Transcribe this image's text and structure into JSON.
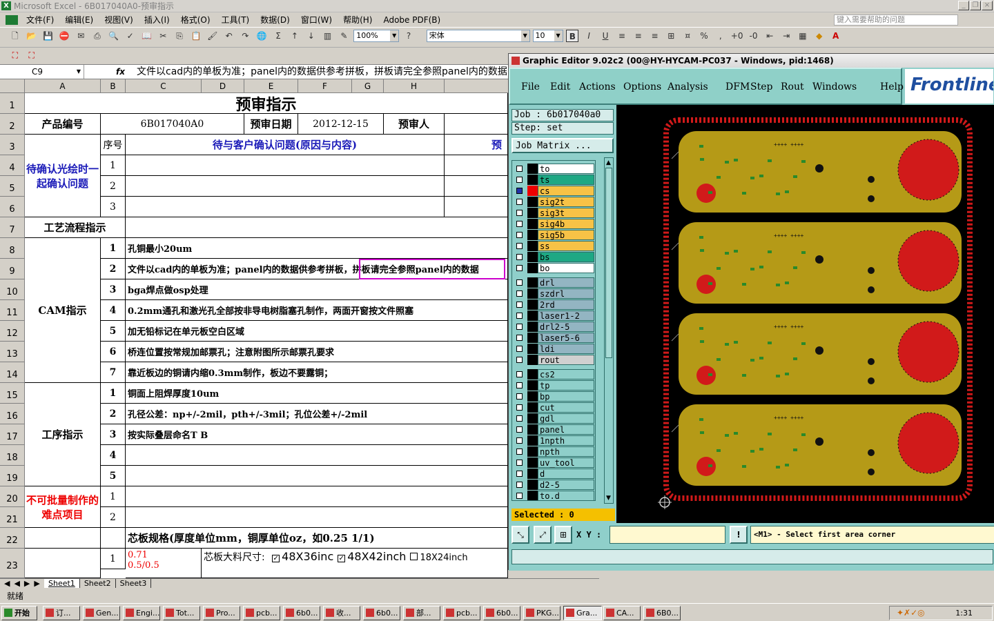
{
  "excel": {
    "title": "Microsoft Excel - 6B017040A0-预审指示",
    "menu": [
      "文件(F)",
      "编辑(E)",
      "视图(V)",
      "插入(I)",
      "格式(O)",
      "工具(T)",
      "数据(D)",
      "窗口(W)",
      "帮助(H)",
      "Adobe PDF(B)"
    ],
    "help_placeholder": "键入需要帮助的问题",
    "zoom": "100%",
    "font_name": "宋体",
    "font_size": "10",
    "name_box": "C9",
    "formula": "文件以cad内的单板为准；panel内的数据供参考拼板，拼板请完全参照panel内的数据",
    "columns": [
      "A",
      "B",
      "C",
      "D",
      "E",
      "F",
      "G",
      "H"
    ],
    "rows": [
      "1",
      "2",
      "3",
      "4",
      "5",
      "6",
      "7",
      "8",
      "9",
      "10",
      "11",
      "12",
      "13",
      "14",
      "15",
      "16",
      "17",
      "18",
      "19",
      "20",
      "21",
      "22",
      "23"
    ],
    "sheet": {
      "title": "预审指示",
      "product_label": "产品编号",
      "product_value": "6B017040A0",
      "date_label": "预审日期",
      "date_value": "2012-12-15",
      "reviewer_label": "预审人",
      "confirm_label": "待确认光绘时一起确认问题",
      "seq_label": "序号",
      "issue_header": "待与客户确认问题(原因与内容)",
      "pre_header": "预",
      "process_label": "工艺流程指示",
      "cam_label": "CAM指示",
      "cam_items": [
        {
          "n": "1",
          "t": "孔铜最小20um"
        },
        {
          "n": "2",
          "t": "文件以cad内的单板为准；panel内的数据供参考拼板，拼板请完全参照panel内的数据"
        },
        {
          "n": "3",
          "t": "bga焊点做osp处理"
        },
        {
          "n": "4",
          "t": "0.2mm通孔和激光孔全部按非导电树脂塞孔制作，两面开窗按文件照塞"
        },
        {
          "n": "5",
          "t": "加无铅标记在单元板空白区域"
        },
        {
          "n": "6",
          "t": "桥连位置按常规加邮票孔；注意附图所示邮票孔要求"
        },
        {
          "n": "7",
          "t": "靠近板边的铜请内缩0.3mm制作，板边不要露铜；"
        }
      ],
      "proc_label": "工序指示",
      "proc_items": [
        {
          "n": "1",
          "t": "铜面上阻焊厚度10um"
        },
        {
          "n": "2",
          "t": "孔径公差：np+/-2mil，pth+/-3mil；孔位公差+/-2mil"
        },
        {
          "n": "3",
          "t": "按实际叠层命名T B"
        },
        {
          "n": "4",
          "t": ""
        },
        {
          "n": "5",
          "t": ""
        }
      ],
      "hard_label": "不可批量制作的难点项目",
      "core_spec": "芯板规格(厚度单位mm，铜厚单位oz，如0.25 1/1)",
      "row23_thk": "0.71",
      "row23_cu": "0.5/0.5",
      "row23_size_label": "芯板大料尺寸:",
      "row23_opts": [
        "48X36inc",
        "48X42inch",
        "18X24inch"
      ]
    },
    "tabs": [
      "Sheet1",
      "Sheet2",
      "Sheet3"
    ],
    "status": "就绪"
  },
  "ge": {
    "title": "Graphic Editor 9.02c2 (00@HY-HYCAM-PC037 - Windows, pid:1468)",
    "menu": [
      "File",
      "Edit",
      "Actions",
      "Options",
      "Analysis",
      "DFM",
      "Step",
      "Rout",
      "Windows",
      "Help"
    ],
    "logo": "Frontline",
    "job": "Job : 6b017040a0",
    "step": "Step: set",
    "matrix_btn": "Job Matrix ...",
    "layers_a": [
      {
        "n": "to",
        "c": "#ffffff"
      },
      {
        "n": "ts",
        "c": "#1ea884"
      },
      {
        "n": "cs",
        "c": "#f7c246"
      },
      {
        "n": "sig2t",
        "c": "#f7c246"
      },
      {
        "n": "sig3t",
        "c": "#f7c246"
      },
      {
        "n": "sig4b",
        "c": "#f7c246"
      },
      {
        "n": "sig5b",
        "c": "#f7c246"
      },
      {
        "n": "ss",
        "c": "#f7c246"
      },
      {
        "n": "bs",
        "c": "#1ea884"
      },
      {
        "n": "bo",
        "c": "#ffffff"
      }
    ],
    "layers_b": [
      {
        "n": "drl",
        "c": "#93b5c2"
      },
      {
        "n": "szdrl",
        "c": "#93b5c2"
      },
      {
        "n": "2rd",
        "c": "#93b5c2"
      },
      {
        "n": "laser1-2",
        "c": "#93b5c2"
      },
      {
        "n": "drl2-5",
        "c": "#93b5c2"
      },
      {
        "n": "laser5-6",
        "c": "#93b5c2"
      },
      {
        "n": "ldi",
        "c": "#93b5c2"
      },
      {
        "n": "rout",
        "c": "#d0d0d0"
      }
    ],
    "layers_c": [
      {
        "n": "cs2",
        "c": "#8fcfca"
      },
      {
        "n": "tp",
        "c": "#8fcfca"
      },
      {
        "n": "bp",
        "c": "#8fcfca"
      },
      {
        "n": "cut",
        "c": "#8fcfca"
      },
      {
        "n": "gdl",
        "c": "#8fcfca"
      },
      {
        "n": "panel",
        "c": "#8fcfca"
      },
      {
        "n": "1npth",
        "c": "#8fcfca"
      },
      {
        "n": "npth",
        "c": "#8fcfca"
      },
      {
        "n": "uv_tool",
        "c": "#8fcfca"
      },
      {
        "n": "d",
        "c": "#8fcfca"
      },
      {
        "n": "d2-5",
        "c": "#8fcfca"
      },
      {
        "n": "to.d",
        "c": "#8fcfca"
      }
    ],
    "selected": "Selected : 0",
    "xy_label": "X Y :",
    "message": "<M1> - Select first area corner",
    "board_color": "#b59a17",
    "border_color": "#d11a1a"
  },
  "taskbar": {
    "start": "开始",
    "items": [
      "订...",
      "Gen...",
      "Engi...",
      "Tot...",
      "Pro...",
      "pcb...",
      "6b0...",
      "收...",
      "6b0...",
      "部...",
      "pcb...",
      "6b0...",
      "PKG...",
      "Gra...",
      "CA...",
      "6B0..."
    ],
    "clock": "1:31"
  }
}
